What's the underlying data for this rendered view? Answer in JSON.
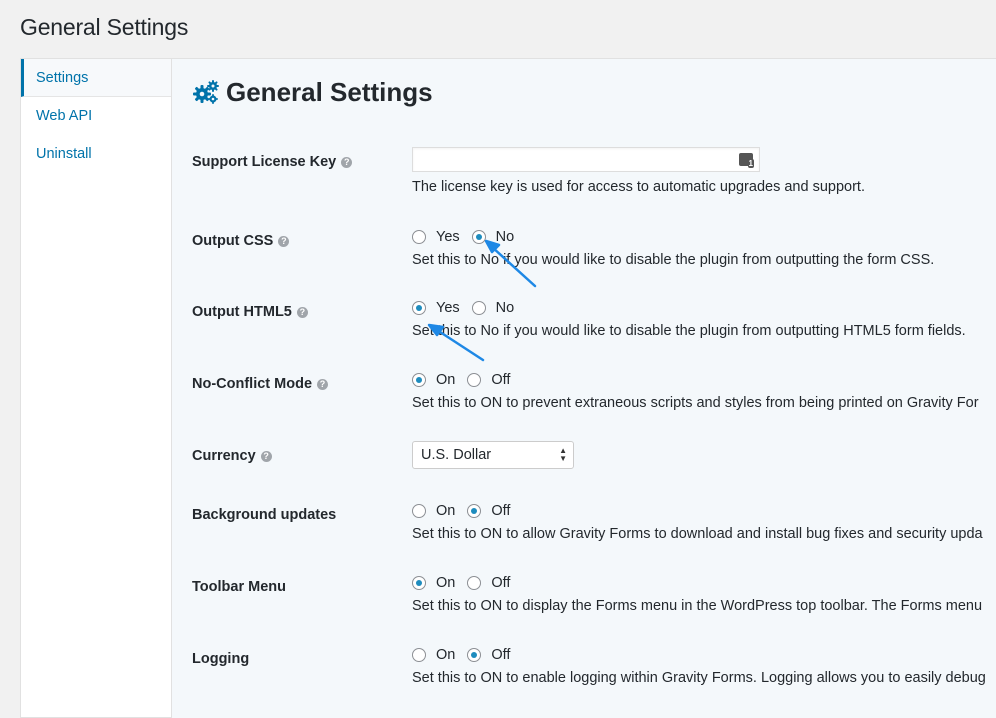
{
  "page": {
    "title": "General Settings"
  },
  "sidebar": {
    "items": [
      {
        "label": "Settings",
        "active": true
      },
      {
        "label": "Web API",
        "active": false
      },
      {
        "label": "Uninstall",
        "active": false
      }
    ]
  },
  "main": {
    "heading": "General Settings",
    "heading_icon": "gears-icon"
  },
  "settings": {
    "license": {
      "label": "Support License Key",
      "value": "",
      "placeholder": "",
      "desc": "The license key is used for access to automatic upgrades and support."
    },
    "output_css": {
      "label": "Output CSS",
      "options": [
        "Yes",
        "No"
      ],
      "selected": "No",
      "desc": "Set this to No if you would like to disable the plugin from outputting the form CSS."
    },
    "output_html5": {
      "label": "Output HTML5",
      "options": [
        "Yes",
        "No"
      ],
      "selected": "Yes",
      "desc": "Set this to No if you would like to disable the plugin from outputting HTML5 form fields."
    },
    "no_conflict": {
      "label": "No-Conflict Mode",
      "options": [
        "On",
        "Off"
      ],
      "selected": "On",
      "desc": "Set this to ON to prevent extraneous scripts and styles from being printed on Gravity For"
    },
    "currency": {
      "label": "Currency",
      "value": "U.S. Dollar"
    },
    "background_updates": {
      "label": "Background updates",
      "options": [
        "On",
        "Off"
      ],
      "selected": "Off",
      "desc": "Set this to ON to allow Gravity Forms to download and install bug fixes and security upda"
    },
    "toolbar_menu": {
      "label": "Toolbar Menu",
      "options": [
        "On",
        "Off"
      ],
      "selected": "On",
      "desc": "Set this to ON to display the Forms menu in the WordPress top toolbar. The Forms menu"
    },
    "logging": {
      "label": "Logging",
      "options": [
        "On",
        "Off"
      ],
      "selected": "Off",
      "desc": "Set this to ON to enable logging within Gravity Forms. Logging allows you to easily debug"
    }
  },
  "annotations": {
    "arrow_color": "#1e88e5"
  },
  "colors": {
    "accent": "#0073aa",
    "radio_dot": "#1e8cbe",
    "background": "#f1f1f1",
    "panel": "#f4f8fb"
  }
}
